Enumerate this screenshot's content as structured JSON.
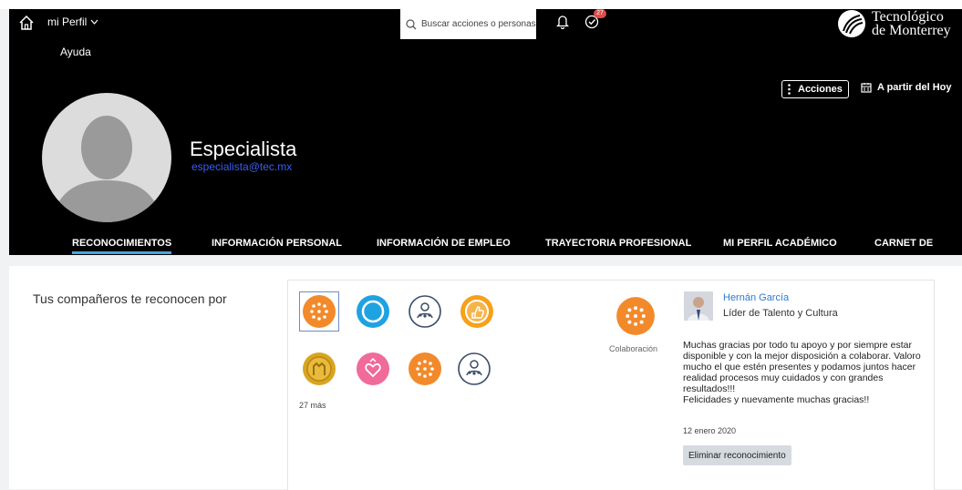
{
  "header": {
    "menu_label": "mi Perfil",
    "help_label": "Ayuda",
    "search_placeholder": "Buscar acciones o personas",
    "notification_count": "27",
    "logo_line1": "Tecnológico",
    "logo_line2": "de Monterrey",
    "actions_label": "Acciones",
    "date_label": "A partir del Hoy"
  },
  "profile": {
    "name": "Especialista",
    "email": "especialista@tec.mx"
  },
  "tabs": [
    {
      "label": "RECONOCIMIENTOS",
      "active": true
    },
    {
      "label": "INFORMACIÓN PERSONAL"
    },
    {
      "label": "INFORMACIÓN DE EMPLEO"
    },
    {
      "label": "TRAYECTORIA PROFESIONAL"
    },
    {
      "label": "MI PERFIL ACADÉMICO"
    },
    {
      "label": "CARNET DE"
    }
  ],
  "recognition": {
    "intro": "Tus compañeros te reconocen por",
    "more_label": "27 más",
    "badges": [
      {
        "icon": "collaboration-badge-icon",
        "color": "#f28a2c"
      },
      {
        "icon": "circle-badge-icon",
        "color": "#1fa3e0"
      },
      {
        "icon": "people-badge-icon",
        "color": "#ffffff"
      },
      {
        "icon": "thumbs-up-badge-icon",
        "color": "#f6a11b"
      },
      {
        "icon": "coin-badge-icon",
        "color": "#d9a520"
      },
      {
        "icon": "heart-hand-badge-icon",
        "color": "#f06a9a"
      },
      {
        "icon": "collaboration-badge-icon",
        "color": "#f28a2c"
      },
      {
        "icon": "people-badge-icon",
        "color": "#ffffff"
      }
    ],
    "selected_badge_label": "Colaboración",
    "giver_name": "Hernán García",
    "giver_role": "Líder de Talento y Cultura",
    "message": "Muchas gracias por todo tu apoyo y por siempre estar disponible y con la mejor disposición a colaborar. Valoro mucho el que estén presentes y podamos juntos hacer realidad procesos muy cuidados y con grandes resultados!!!\nFelicidades y nuevamente muchas gracias!!",
    "date": "12 enero 2020",
    "delete_label": "Eliminar reconocimiento"
  },
  "colors": {
    "accent": "#4aa3e0",
    "email": "#3a5ef2",
    "link": "#2a7bd2",
    "badge": "#e04a4a"
  }
}
